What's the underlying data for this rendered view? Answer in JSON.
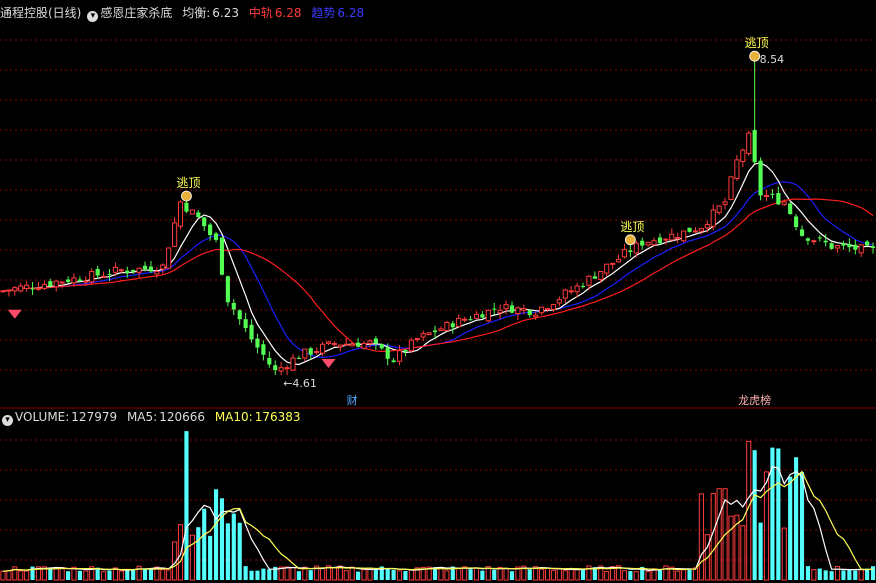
{
  "header": {
    "stock_name": "通程控股(日线)",
    "indicator": "感恩庄家杀底",
    "balance_label": "均衡:",
    "balance_value": "6.23",
    "mid_label": "中轨",
    "mid_value": "6.28",
    "trend_label": "趋势",
    "trend_value": "6.28"
  },
  "volume_header": {
    "volume_label": "VOLUME:",
    "volume_value": "127979",
    "ma5_label": "MA5:",
    "ma5_value": "120666",
    "ma10_label": "MA10:",
    "ma10_value": "176383"
  },
  "colors": {
    "background": "#000000",
    "up": "#ff3c3c",
    "down": "#54ffff",
    "down_candle": "#54ff54",
    "grid": "#8a0000",
    "ma_white": "#ffffff",
    "ma_blue": "#1e1eff",
    "ma_red": "#ff1e1e",
    "ma10_yellow": "#ffff54",
    "header_white": "#dcdcdc",
    "header_red": "#ff3c3c",
    "header_blue": "#3c3cff",
    "header_yellow": "#ffff54"
  },
  "chart_data": [
    {
      "type": "candlestick",
      "annotations": [
        {
          "text": "逃顶",
          "kind": "escape-top",
          "bar": 31
        },
        {
          "text": "逃顶",
          "kind": "escape-top",
          "bar": 106
        },
        {
          "text": "逃顶",
          "kind": "escape-top",
          "bar": 127
        },
        {
          "text": "8.54",
          "kind": "high-label",
          "bar": 127
        },
        {
          "text": "4.61",
          "kind": "low-label",
          "bar": 46
        },
        {
          "text": "财",
          "kind": "bottom-marker",
          "bar": 59
        },
        {
          "text": "龙虎榜",
          "kind": "bottom-marker",
          "bar": 127
        }
      ],
      "bottom_signals": [
        2,
        55
      ],
      "candles": []
    },
    {
      "type": "bar",
      "series": [
        {
          "name": "VOLUME",
          "values": []
        },
        {
          "name": "MA5",
          "values": []
        },
        {
          "name": "MA10",
          "values": []
        }
      ]
    }
  ]
}
